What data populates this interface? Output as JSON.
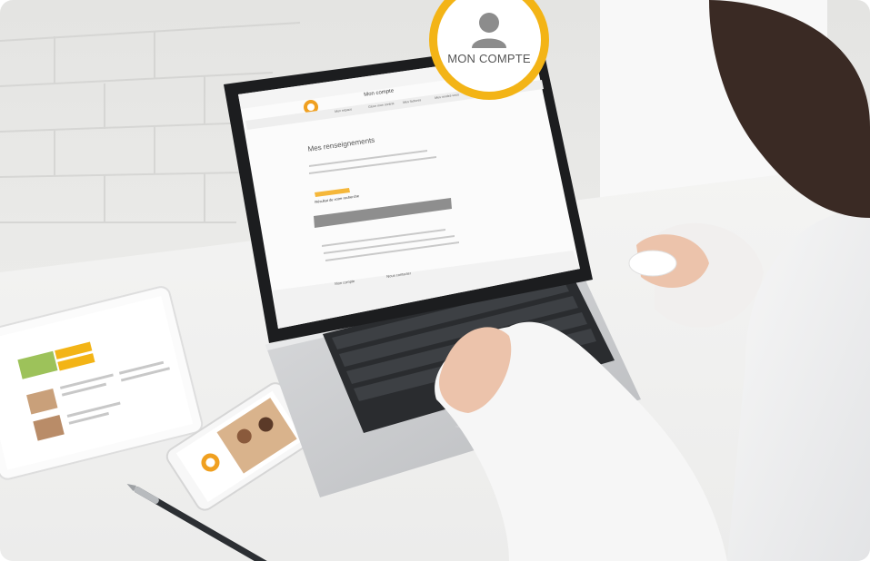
{
  "badge": {
    "label": "MON COMPTE",
    "icon": "user-icon",
    "colors": {
      "ring": "#f3b416",
      "icon": "#8c8c8c"
    }
  },
  "laptop_screen": {
    "brand_colors": {
      "orange": "#f0a020",
      "accent_button": "#f5b73a"
    },
    "header": {
      "menu_label": "Mon compte",
      "nav_items": [
        "Mon espace",
        "Gérer mon contrat",
        "Mes factures",
        "Mes rendez-vous"
      ]
    },
    "page_title": "Mes renseignements",
    "section_title": "Résultat de votre recherche",
    "footer": {
      "col1_title": "Mon compte",
      "col2_title": "Nous contacter"
    }
  }
}
